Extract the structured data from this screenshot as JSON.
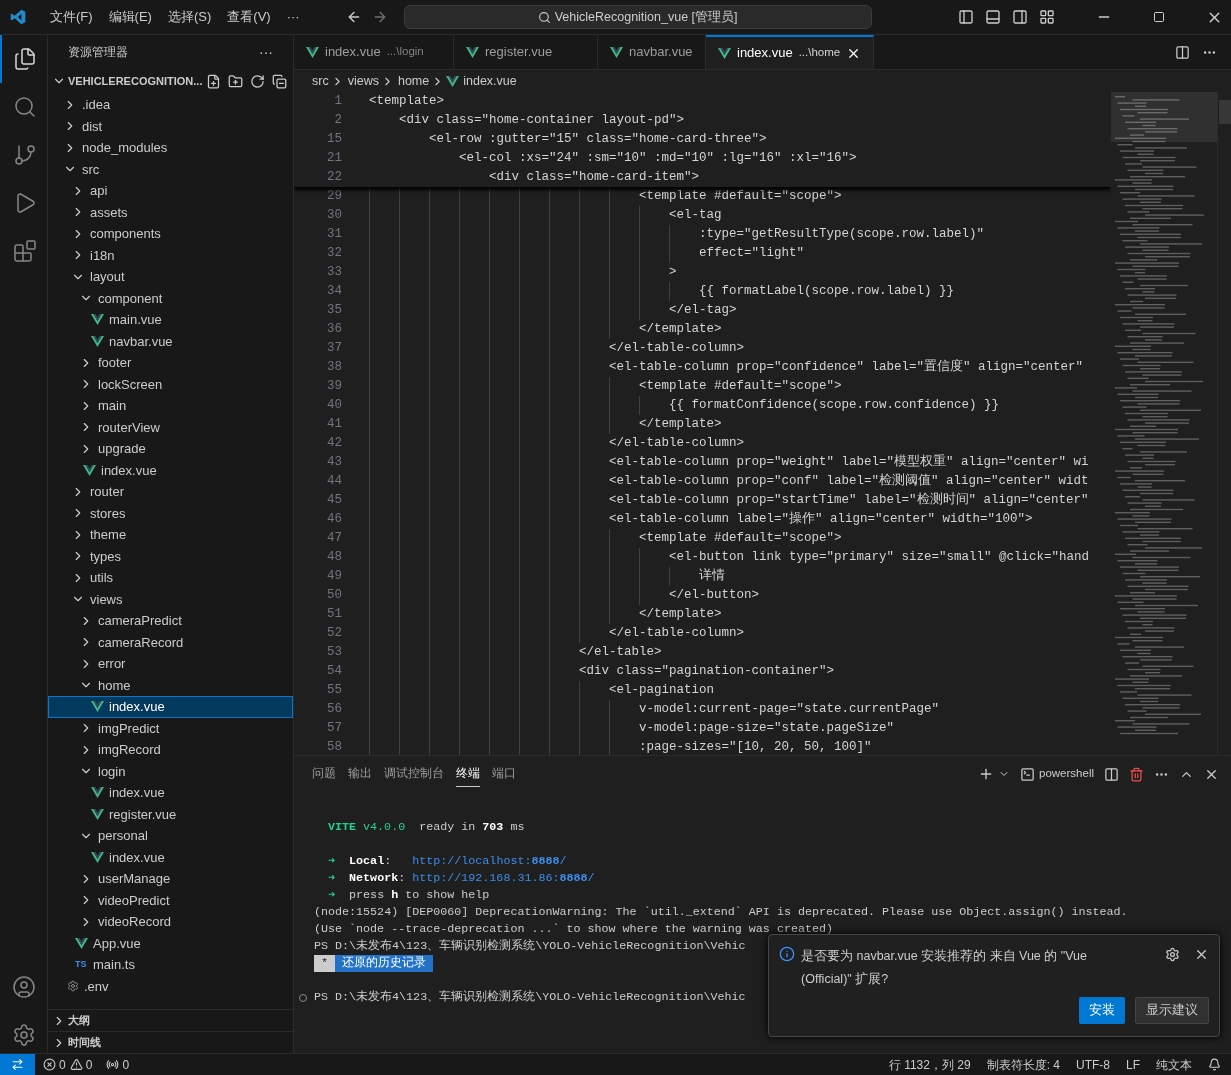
{
  "title_bar": {
    "menus": [
      "文件(F)",
      "编辑(E)",
      "选择(S)",
      "查看(V)"
    ],
    "more": "···",
    "command_center": "VehicleRecognition_vue [管理员]"
  },
  "activity_bar": {
    "items": [
      {
        "kind": "explorer",
        "selected": true
      },
      {
        "kind": "search",
        "selected": false
      },
      {
        "kind": "source_control",
        "selected": false
      },
      {
        "kind": "run",
        "selected": false
      },
      {
        "kind": "extensions",
        "selected": false
      }
    ],
    "bottom": [
      {
        "kind": "account"
      },
      {
        "kind": "settings"
      }
    ]
  },
  "sidebar": {
    "title": "资源管理器",
    "more": "···",
    "root": "VEHICLERECOGNITION...",
    "tree": [
      {
        "label": ".idea",
        "kind": "folder",
        "expanded": false,
        "selected": false
      },
      {
        "label": "dist",
        "kind": "folder",
        "expanded": false,
        "selected": false
      },
      {
        "label": "node_modules",
        "kind": "folder",
        "expanded": false,
        "selected": false
      },
      {
        "label": "src",
        "kind": "folder",
        "expanded": true,
        "selected": false,
        "children": [
          {
            "label": "api",
            "kind": "folder",
            "expanded": false,
            "selected": false
          },
          {
            "label": "assets",
            "kind": "folder",
            "expanded": false,
            "selected": false
          },
          {
            "label": "components",
            "kind": "folder",
            "expanded": false,
            "selected": false
          },
          {
            "label": "i18n",
            "kind": "folder",
            "expanded": false,
            "selected": false
          },
          {
            "label": "layout",
            "kind": "folder",
            "expanded": true,
            "selected": false,
            "children": [
              {
                "label": "component",
                "kind": "folder",
                "expanded": true,
                "selected": false,
                "children": [
                  {
                    "label": "main.vue",
                    "kind": "vue",
                    "selected": false
                  },
                  {
                    "label": "navbar.vue",
                    "kind": "vue",
                    "selected": false
                  }
                ]
              },
              {
                "label": "footer",
                "kind": "folder",
                "expanded": false,
                "selected": false
              },
              {
                "label": "lockScreen",
                "kind": "folder",
                "expanded": false,
                "selected": false
              },
              {
                "label": "main",
                "kind": "folder",
                "expanded": false,
                "selected": false
              },
              {
                "label": "routerView",
                "kind": "folder",
                "expanded": false,
                "selected": false
              },
              {
                "label": "upgrade",
                "kind": "folder",
                "expanded": false,
                "selected": false
              },
              {
                "label": "index.vue",
                "kind": "vue",
                "selected": false
              }
            ]
          },
          {
            "label": "router",
            "kind": "folder",
            "expanded": false,
            "selected": false
          },
          {
            "label": "stores",
            "kind": "folder",
            "expanded": false,
            "selected": false
          },
          {
            "label": "theme",
            "kind": "folder",
            "expanded": false,
            "selected": false
          },
          {
            "label": "types",
            "kind": "folder",
            "expanded": false,
            "selected": false
          },
          {
            "label": "utils",
            "kind": "folder",
            "expanded": false,
            "selected": false
          },
          {
            "label": "views",
            "kind": "folder",
            "expanded": true,
            "selected": false,
            "children": [
              {
                "label": "cameraPredict",
                "kind": "folder",
                "expanded": false,
                "selected": false
              },
              {
                "label": "cameraRecord",
                "kind": "folder",
                "expanded": false,
                "selected": false
              },
              {
                "label": "error",
                "kind": "folder",
                "expanded": false,
                "selected": false
              },
              {
                "label": "home",
                "kind": "folder",
                "expanded": true,
                "selected": false,
                "children": [
                  {
                    "label": "index.vue",
                    "kind": "vue",
                    "selected": true
                  }
                ]
              },
              {
                "label": "imgPredict",
                "kind": "folder",
                "expanded": false,
                "selected": false
              },
              {
                "label": "imgRecord",
                "kind": "folder",
                "expanded": false,
                "selected": false
              },
              {
                "label": "login",
                "kind": "folder",
                "expanded": true,
                "selected": false,
                "children": [
                  {
                    "label": "index.vue",
                    "kind": "vue",
                    "selected": false
                  },
                  {
                    "label": "register.vue",
                    "kind": "vue",
                    "selected": false
                  }
                ]
              },
              {
                "label": "personal",
                "kind": "folder",
                "expanded": true,
                "selected": false,
                "children": [
                  {
                    "label": "index.vue",
                    "kind": "vue",
                    "selected": false
                  }
                ]
              },
              {
                "label": "userManage",
                "kind": "folder",
                "expanded": false,
                "selected": false
              },
              {
                "label": "videoPredict",
                "kind": "folder",
                "expanded": false,
                "selected": false
              },
              {
                "label": "videoRecord",
                "kind": "folder",
                "expanded": false,
                "selected": false
              }
            ]
          },
          {
            "label": "App.vue",
            "kind": "vue",
            "selected": false
          },
          {
            "label": "main.ts",
            "kind": "ts",
            "icon_text": "TS",
            "selected": false
          }
        ]
      },
      {
        "label": ".env",
        "kind": "env",
        "selected": false
      }
    ],
    "sections": [
      "大纲",
      "时间线"
    ]
  },
  "tabs": [
    {
      "label": "index.vue",
      "hint": "...\\login",
      "selected": false
    },
    {
      "label": "register.vue",
      "selected": false
    },
    {
      "label": "navbar.vue",
      "selected": false
    },
    {
      "label": "index.vue",
      "hint": "...\\home",
      "selected": true
    }
  ],
  "breadcrumb": [
    "src",
    "views",
    "home",
    "index.vue"
  ],
  "editor": {
    "sticky_lines": [
      {
        "number": "1",
        "text": "<template>"
      },
      {
        "number": "2",
        "text": "    <div class=\"home-container layout-pd\">"
      },
      {
        "number": "15",
        "text": "        <el-row :gutter=\"15\" class=\"home-card-three\">"
      },
      {
        "number": "21",
        "text": "            <el-col :xs=\"24\" :sm=\"10\" :md=\"10\" :lg=\"16\" :xl=\"16\">"
      },
      {
        "number": "22",
        "text": "                <div class=\"home-card-item\">"
      }
    ],
    "lines": [
      {
        "number": "29",
        "text": "                                    <template #default=\"scope\">"
      },
      {
        "number": "30",
        "text": "                                        <el-tag"
      },
      {
        "number": "31",
        "text": "                                            :type=\"getResultType(scope.row.label)\""
      },
      {
        "number": "32",
        "text": "                                            effect=\"light\""
      },
      {
        "number": "33",
        "text": "                                        >"
      },
      {
        "number": "34",
        "text": "                                            {{ formatLabel(scope.row.label) }}"
      },
      {
        "number": "35",
        "text": "                                        </el-tag>"
      },
      {
        "number": "36",
        "text": "                                    </template>"
      },
      {
        "number": "37",
        "text": "                                </el-table-column>"
      },
      {
        "number": "38",
        "text": "                                <el-table-column prop=\"confidence\" label=\"置信度\" align=\"center\""
      },
      {
        "number": "39",
        "text": "                                    <template #default=\"scope\">"
      },
      {
        "number": "40",
        "text": "                                        {{ formatConfidence(scope.row.confidence) }}"
      },
      {
        "number": "41",
        "text": "                                    </template>"
      },
      {
        "number": "42",
        "text": "                                </el-table-column>"
      },
      {
        "number": "43",
        "text": "                                <el-table-column prop=\"weight\" label=\"模型权重\" align=\"center\" wi"
      },
      {
        "number": "44",
        "text": "                                <el-table-column prop=\"conf\" label=\"检测阈值\" align=\"center\" widt"
      },
      {
        "number": "45",
        "text": "                                <el-table-column prop=\"startTime\" label=\"检测时间\" align=\"center\""
      },
      {
        "number": "46",
        "text": "                                <el-table-column label=\"操作\" align=\"center\" width=\"100\">"
      },
      {
        "number": "47",
        "text": "                                    <template #default=\"scope\">"
      },
      {
        "number": "48",
        "text": "                                        <el-button link type=\"primary\" size=\"small\" @click=\"hand"
      },
      {
        "number": "49",
        "text": "                                            详情"
      },
      {
        "number": "50",
        "text": "                                        </el-button>"
      },
      {
        "number": "51",
        "text": "                                    </template>"
      },
      {
        "number": "52",
        "text": "                                </el-table-column>"
      },
      {
        "number": "53",
        "text": "                            </el-table>"
      },
      {
        "number": "54",
        "text": "                            <div class=\"pagination-container\">"
      },
      {
        "number": "55",
        "text": "                                <el-pagination"
      },
      {
        "number": "56",
        "text": "                                    v-model:current-page=\"state.currentPage\""
      },
      {
        "number": "57",
        "text": "                                    v-model:page-size=\"state.pageSize\""
      },
      {
        "number": "58",
        "text": "                                    :page-sizes=\"[10, 20, 50, 100]\""
      }
    ]
  },
  "panel": {
    "tabs": [
      {
        "label": "问题",
        "selected": false
      },
      {
        "label": "输出",
        "selected": false
      },
      {
        "label": "调试控制台",
        "selected": false
      },
      {
        "label": "终端",
        "selected": true
      },
      {
        "label": "端口",
        "selected": false
      }
    ],
    "shell": "powershell",
    "terminal": [
      {
        "lines": [
          {
            "kind": "indented",
            "marker": false,
            "segments": [
              {
                "kind": "accent_bold",
                "text": "VITE"
              },
              {
                "kind": "accent",
                "text": " v4.0.0"
              },
              {
                "kind": "plain",
                "text": "  ready in "
              },
              {
                "kind": "bold",
                "text": "703"
              },
              {
                "kind": "plain",
                "text": " ms"
              }
            ]
          }
        ]
      },
      {
        "lines": [
          {
            "kind": "indented",
            "marker": false,
            "segments": [
              {
                "kind": "accent",
                "text": "➜ "
              },
              {
                "kind": "bold",
                "text": " Local"
              },
              {
                "kind": "plain",
                "text": ":   "
              },
              {
                "kind": "link",
                "text": "http://localhost:"
              },
              {
                "kind": "link_bold",
                "text": "8888"
              },
              {
                "kind": "link",
                "text": "/"
              }
            ]
          },
          {
            "kind": "indented",
            "marker": false,
            "segments": [
              {
                "kind": "accent",
                "text": "➜ "
              },
              {
                "kind": "bold",
                "text": " Network"
              },
              {
                "kind": "plain",
                "text": ": "
              },
              {
                "kind": "link",
                "text": "http://192.168.31.86:"
              },
              {
                "kind": "link_bold",
                "text": "8888"
              },
              {
                "kind": "link",
                "text": "/"
              }
            ]
          },
          {
            "kind": "indented",
            "marker": false,
            "segments": [
              {
                "kind": "accent",
                "text": "➜ "
              },
              {
                "kind": "plain",
                "text": " press "
              },
              {
                "kind": "bold",
                "text": "h"
              },
              {
                "kind": "plain",
                "text": " to show help"
              }
            ]
          },
          {
            "marker": false,
            "segments": [
              {
                "kind": "plain",
                "text": "(node:15524) [DEP0060] DeprecationWarning: The `util._extend` API is deprecated. Please use Object.assign() instead."
              }
            ]
          },
          {
            "marker": false,
            "segments": [
              {
                "kind": "plain",
                "text": "(Use `node --trace-deprecation ...` to show where the warning was created)"
              }
            ]
          },
          {
            "marker": false,
            "segments": [
              {
                "kind": "plain",
                "text": "PS D:\\未发布4\\123、车辆识别检测系统\\YOLO-VehicleRecognition\\Vehic"
              }
            ]
          },
          {
            "marker": false,
            "segments": [
              {
                "kind": "badge",
                "text": " * "
              },
              {
                "kind": "highlight",
                "text": " 还原的历史记录 "
              }
            ]
          }
        ]
      },
      {
        "lines": [
          {
            "marker": true,
            "segments": [
              {
                "kind": "plain",
                "text": "PS D:\\未发布4\\123、车辆识别检测系统\\YOLO-VehicleRecognition\\Vehic"
              }
            ]
          }
        ]
      }
    ]
  },
  "notification": {
    "message": "是否要为 navbar.vue 安装推荐的 来自 Vue 的 \"Vue (Official)\" 扩展?",
    "buttons": [
      {
        "label": "安装",
        "kind": "primary"
      },
      {
        "label": "显示建议",
        "kind": "secondary"
      }
    ]
  },
  "status_bar": {
    "errors": "0",
    "warnings": "0",
    "ports": "0",
    "items": [
      "行 1132，列 29",
      "制表符长度: 4",
      "UTF-8",
      "LF",
      "纯文本"
    ]
  }
}
